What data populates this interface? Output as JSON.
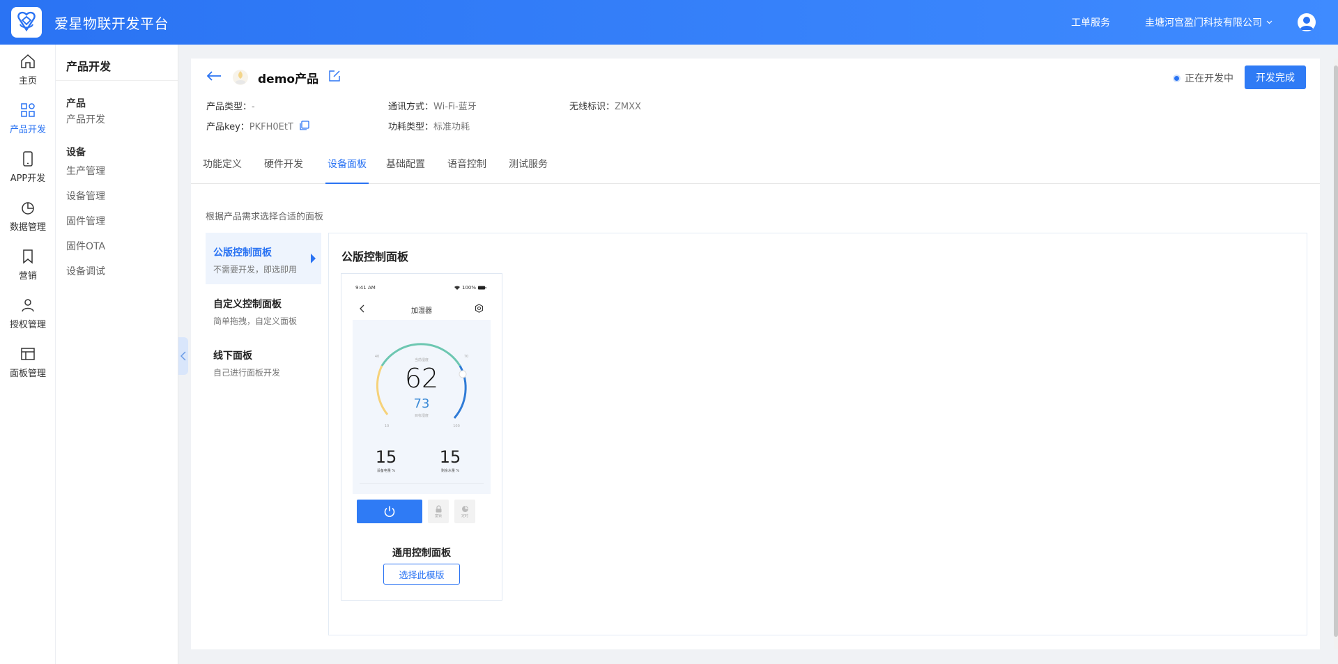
{
  "app": {
    "brand": "爱星物联开发平台"
  },
  "topbar": {
    "ticket_service": "工单服务",
    "company": "圭塘河宫盈门科技有限公司"
  },
  "iconnav": {
    "items": [
      {
        "label": "主页",
        "icon": "home-icon"
      },
      {
        "label": "产品开发",
        "icon": "grid-icon",
        "active": true
      },
      {
        "label": "APP开发",
        "icon": "phone-icon"
      },
      {
        "label": "数据管理",
        "icon": "pie-chart-icon"
      },
      {
        "label": "营销",
        "icon": "bookmark-icon"
      },
      {
        "label": "授权管理",
        "icon": "user-icon"
      },
      {
        "label": "面板管理",
        "icon": "panel-icon"
      }
    ]
  },
  "subnav": {
    "title": "产品开发",
    "group1": "产品",
    "group1_items": [
      "产品开发"
    ],
    "group2": "设备",
    "group2_items": [
      "生产管理",
      "设备管理",
      "固件管理",
      "固件OTA",
      "设备调试"
    ]
  },
  "product": {
    "name": "demo产品",
    "status": "正在开发中",
    "done_button": "开发完成",
    "meta": {
      "type_label": "产品类型：",
      "type_value": "-",
      "comm_label": "通讯方式：",
      "comm_value": "Wi-Fi-蓝牙",
      "wireless_label": "无线标识：",
      "wireless_value": "ZMXX",
      "key_label": "产品key：",
      "key_value": "PKFH0EtT",
      "power_label": "功耗类型：",
      "power_value": "标准功耗"
    }
  },
  "tabs": [
    "功能定义",
    "硬件开发",
    "设备面板",
    "基础配置",
    "语音控制",
    "测试服务"
  ],
  "active_tab": "设备面板",
  "panel_section": {
    "hint": "根据产品需求选择合适的面板",
    "options": [
      {
        "title": "公版控制面板",
        "desc": "不需要开发，即选即用",
        "active": true
      },
      {
        "title": "自定义控制面板",
        "desc": "简单拖拽，自定义面板"
      },
      {
        "title": "线下面板",
        "desc": "自己进行面板开发"
      }
    ],
    "panel_title": "公版控制面板",
    "template": {
      "name": "通用控制面板",
      "choose_button": "选择此模版",
      "phone": {
        "time": "9:41 AM",
        "battery": "100%",
        "title": "加湿器",
        "gauge_caption": "当前湿度",
        "gauge_value": "62",
        "gauge_target": "73",
        "target_caption": "目标湿度",
        "tick_40": "40",
        "tick_70": "70",
        "tick_10": "10",
        "tick_100": "100",
        "stat1_value": "15",
        "stat1_label": "设备电量 %",
        "stat2_value": "15",
        "stat2_label": "剩余水量 %",
        "btn_lock": "童锁",
        "btn_timer": "定时"
      }
    }
  }
}
